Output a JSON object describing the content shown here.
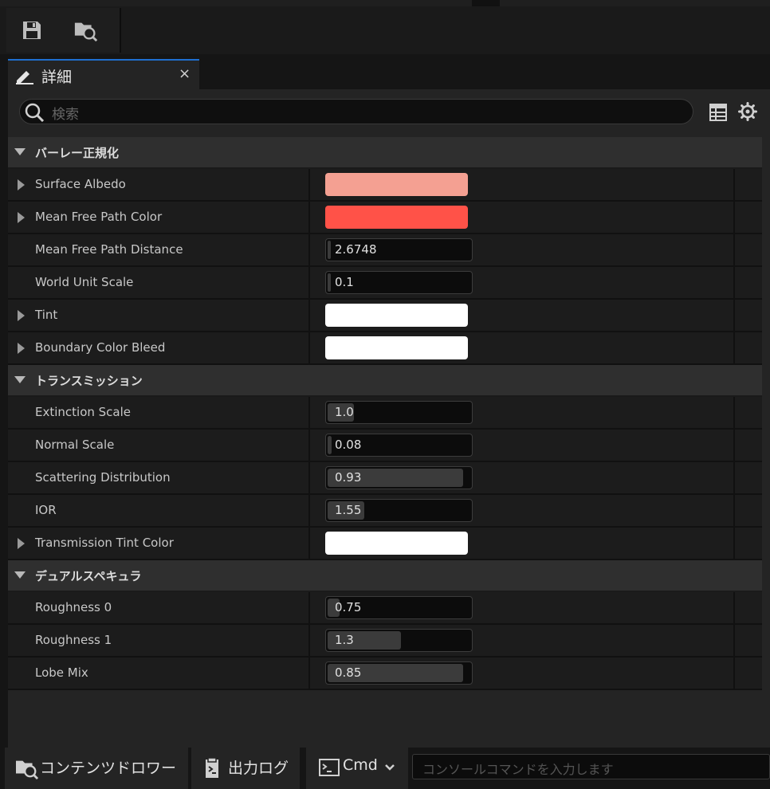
{
  "toolbar": {
    "save_icon": "save-icon",
    "browse_icon": "folder-search-icon"
  },
  "tab": {
    "title": "詳細",
    "close": "×"
  },
  "search": {
    "placeholder": "検索"
  },
  "categories": [
    {
      "label": "バーレー正規化",
      "rows": [
        {
          "label": "Surface Albedo",
          "expandable": true,
          "type": "color",
          "color": "#f4a092"
        },
        {
          "label": "Mean Free Path Color",
          "expandable": true,
          "type": "color",
          "color": "#ff5248"
        },
        {
          "label": "Mean Free Path Distance",
          "expandable": false,
          "type": "number",
          "value": "2.6748",
          "fill": 0.02
        },
        {
          "label": "World Unit Scale",
          "expandable": false,
          "type": "number",
          "value": "0.1",
          "fill": 0
        },
        {
          "label": "Tint",
          "expandable": true,
          "type": "color",
          "color": "#ffffff"
        },
        {
          "label": "Boundary Color Bleed",
          "expandable": true,
          "type": "color",
          "color": "#ffffff"
        }
      ]
    },
    {
      "label": "トランスミッション",
      "rows": [
        {
          "label": "Extinction Scale",
          "expandable": false,
          "type": "number",
          "value": "1.0",
          "fill": 0.18
        },
        {
          "label": "Normal Scale",
          "expandable": false,
          "type": "number",
          "value": "0.08",
          "fill": 0.03
        },
        {
          "label": "Scattering Distribution",
          "expandable": false,
          "type": "number",
          "value": "0.93",
          "fill": 0.93
        },
        {
          "label": "IOR",
          "expandable": false,
          "type": "number",
          "value": "1.55",
          "fill": 0.25
        },
        {
          "label": "Transmission Tint Color",
          "expandable": true,
          "type": "color",
          "color": "#ffffff"
        }
      ]
    },
    {
      "label": "デュアルスペキュラ",
      "rows": [
        {
          "label": "Roughness 0",
          "expandable": false,
          "type": "number",
          "value": "0.75",
          "fill": 0.08
        },
        {
          "label": "Roughness 1",
          "expandable": false,
          "type": "number",
          "value": "1.3",
          "fill": 0.5
        },
        {
          "label": "Lobe Mix",
          "expandable": false,
          "type": "number",
          "value": "0.85",
          "fill": 0.93
        }
      ]
    }
  ],
  "bottom": {
    "content_drawer": "コンテンツドロワー",
    "output_log": "出力ログ",
    "cmd": "Cmd",
    "console_placeholder": "コンソールコマンドを入力します"
  }
}
